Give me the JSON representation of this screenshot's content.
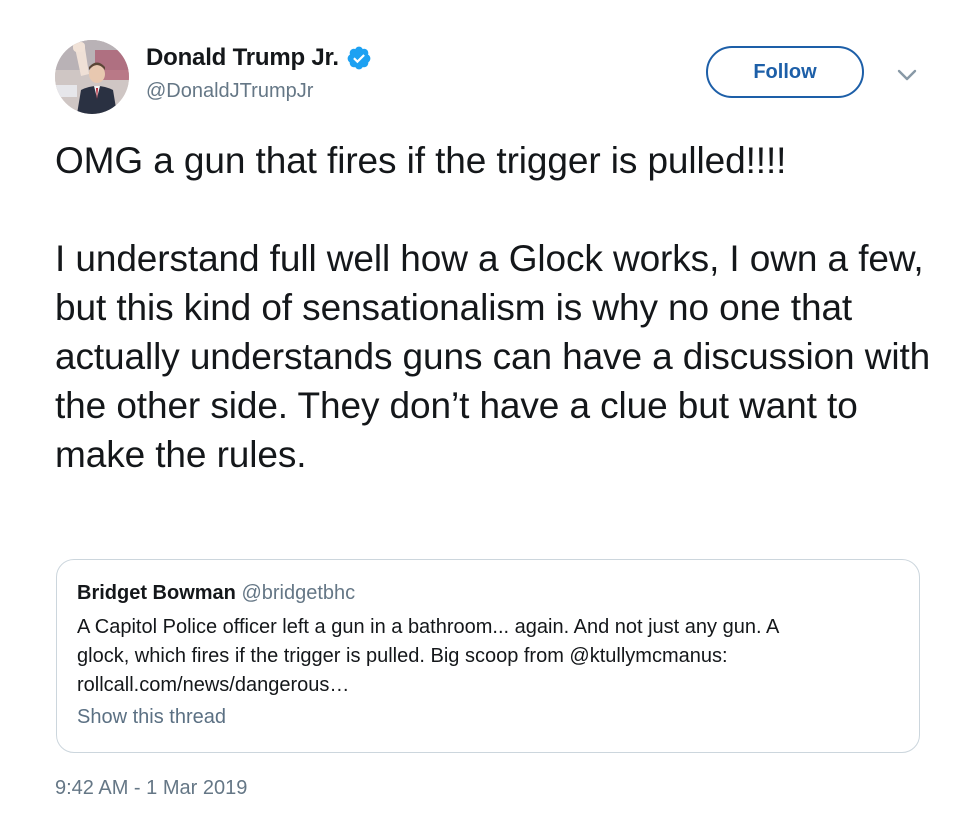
{
  "author": {
    "display_name": "Donald Trump Jr.",
    "handle": "@DonaldJTrumpJr",
    "verified": true,
    "verified_color": "#1da1f2"
  },
  "actions": {
    "follow_label": "Follow"
  },
  "tweet": {
    "paragraphs": [
      "OMG a gun that fires if the trigger is pulled!!!!",
      "I understand full well how a Glock works, I own a few, but this kind of sensationalism is why no one that actually understands guns can have a discussion with the other side. They don’t have a clue but want to make the rules."
    ],
    "timestamp": "9:42 AM - 1 Mar 2019"
  },
  "quoted_tweet": {
    "display_name": "Bridget Bowman",
    "handle": "@bridgetbhc",
    "lines": [
      "A Capitol Police officer left a gun in a bathroom... again. And not just any gun. A",
      "glock, which fires if the trigger is pulled. Big scoop from @ktullymcmanus:",
      "rollcall.com/news/dangerous…"
    ],
    "show_thread_label": "Show this thread"
  },
  "colors": {
    "text": "#14171a",
    "secondary_text": "#657786",
    "follow_accent": "#1d5fa8",
    "card_border": "#ccd6dd"
  },
  "icons": [
    "avatar",
    "verified-badge-icon",
    "chevron-down-icon"
  ]
}
